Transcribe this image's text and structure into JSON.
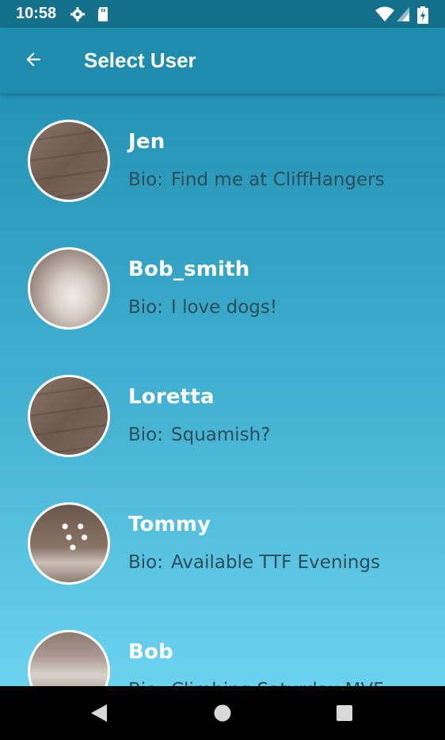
{
  "status_bar": {
    "time": "10:58",
    "icons": [
      "settings-icon",
      "sd-card-icon",
      "wifi-icon",
      "cell-signal-icon",
      "battery-charging-icon"
    ]
  },
  "app_bar": {
    "title": "Select User",
    "back_icon": "arrow-back-icon"
  },
  "users": [
    {
      "name": "Jen",
      "bio_label": "Bio:",
      "bio": "Find me at CliffHangers",
      "avatar": "wood"
    },
    {
      "name": "Bob_smith",
      "bio_label": "Bio:",
      "bio": "I love dogs!",
      "avatar": "hall"
    },
    {
      "name": "Loretta",
      "bio_label": "Bio:",
      "bio": "Squamish?",
      "avatar": "wood"
    },
    {
      "name": "Tommy",
      "bio_label": "Bio:",
      "bio": "Available TTF Evenings",
      "avatar": "ceiling"
    },
    {
      "name": "Bob",
      "bio_label": "Bio:",
      "bio": "Climbing Saturday MVF",
      "avatar": "sofa"
    }
  ],
  "nav_bar": {
    "buttons": [
      "back-triangle-icon",
      "home-circle-icon",
      "recents-square-icon"
    ]
  },
  "colors": {
    "status_bar": "#15708c",
    "app_bar": "#1f8cae",
    "background_top": "#1e8aab",
    "background_bottom": "#6bd2ee",
    "bio_text": "#2c4d5a"
  }
}
